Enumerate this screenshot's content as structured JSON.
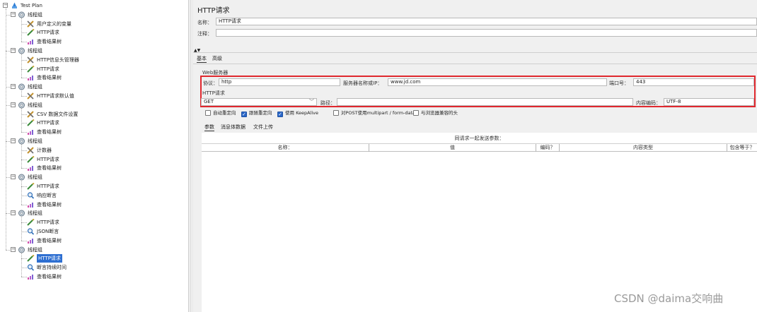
{
  "tree": {
    "root": "Test Plan",
    "groups": [
      {
        "label": "线程组",
        "children": [
          {
            "label": "用户定义的变量",
            "icon": "wrench-icon"
          },
          {
            "label": "HTTP请求",
            "icon": "sampler-pen-icon"
          },
          {
            "label": "查看结果树",
            "icon": "chart-listener-icon"
          }
        ]
      },
      {
        "label": "线程组",
        "children": [
          {
            "label": "HTTP信息头管理器",
            "icon": "wrench-icon"
          },
          {
            "label": "HTTP请求",
            "icon": "sampler-pen-icon"
          },
          {
            "label": "查看结果树",
            "icon": "chart-listener-icon"
          }
        ]
      },
      {
        "label": "线程组",
        "children": [
          {
            "label": "HTTP请求默认值",
            "icon": "wrench-icon"
          }
        ]
      },
      {
        "label": "线程组",
        "children": [
          {
            "label": "CSV 数据文件设置",
            "icon": "wrench-icon"
          },
          {
            "label": "HTTP请求",
            "icon": "sampler-pen-icon"
          },
          {
            "label": "查看结果树",
            "icon": "chart-listener-icon"
          }
        ]
      },
      {
        "label": "线程组",
        "children": [
          {
            "label": "计数器",
            "icon": "wrench-icon"
          },
          {
            "label": "HTTP请求",
            "icon": "sampler-pen-icon"
          },
          {
            "label": "查看结果树",
            "icon": "chart-listener-icon"
          }
        ]
      },
      {
        "label": "线程组",
        "children": [
          {
            "label": "HTTP请求",
            "icon": "sampler-pen-icon"
          },
          {
            "label": "响应断言",
            "icon": "magnifier-icon"
          },
          {
            "label": "查看结果树",
            "icon": "chart-listener-icon"
          }
        ]
      },
      {
        "label": "线程组",
        "children": [
          {
            "label": "HTTP请求",
            "icon": "sampler-pen-icon"
          },
          {
            "label": "JSON断言",
            "icon": "magnifier-icon"
          },
          {
            "label": "查看结果树",
            "icon": "chart-listener-icon"
          }
        ]
      },
      {
        "label": "线程组",
        "children": [
          {
            "label": "HTTP请求",
            "icon": "sampler-pen-icon",
            "selected": true
          },
          {
            "label": "断言持续时间",
            "icon": "magnifier-icon"
          },
          {
            "label": "查看结果树",
            "icon": "chart-listener-icon"
          }
        ]
      }
    ]
  },
  "panel": {
    "title": "HTTP请求",
    "name_label": "名称：",
    "name_value": "HTTP请求",
    "comment_label": "注释：",
    "comment_value": "",
    "tabs": [
      "基本",
      "高级"
    ],
    "web_server_label": "Web服务器",
    "protocol_label": "协议：",
    "protocol_value": "http",
    "server_label": "服务器名称或IP：",
    "server_value": "www.jd.com",
    "port_label": "端口号：",
    "port_value": "443",
    "http_request_label": "HTTP请求",
    "method_value": "GET",
    "path_label": "路径：",
    "path_value": "",
    "encoding_label": "内容编码：",
    "encoding_value": "UTF-8",
    "checkboxes": [
      {
        "label": "自动重定向",
        "checked": false
      },
      {
        "label": "跟随重定向",
        "checked": true
      },
      {
        "label": "使用 KeepAlive",
        "checked": true
      },
      {
        "label": "对POST使用multipart / form-data",
        "checked": false
      },
      {
        "label": "与浏览器兼容的头",
        "checked": false
      }
    ],
    "sub_tabs": [
      "参数",
      "消息体数据",
      "文件上传"
    ],
    "table_caption": "同请求一起发送参数：",
    "table_headers": [
      "名称：",
      "值",
      "编码？",
      "内容类型",
      "包含等于？"
    ]
  },
  "watermark": "CSDN @daima交响曲",
  "colors": {
    "highlight": "#e0282e",
    "selection": "#2e6fd1",
    "checkbox_on": "#2966c7"
  }
}
